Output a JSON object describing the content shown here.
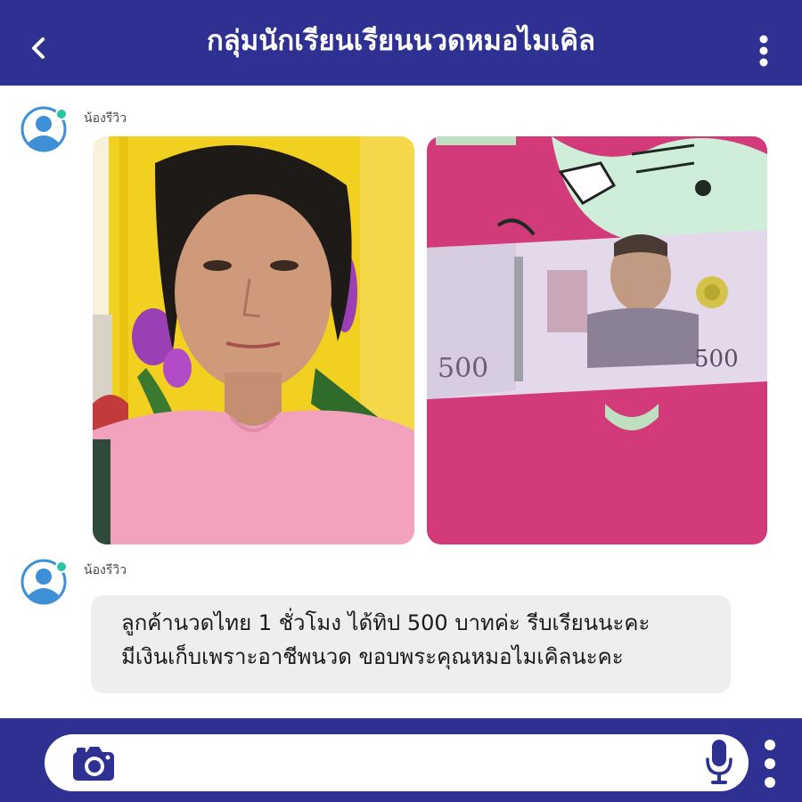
{
  "header": {
    "title": "กลุ่มนักเรียนเรียนนวดหมอไมเคิล",
    "back_icon": "chevron-left-icon",
    "menu_icon": "more-vertical-icon"
  },
  "messages": [
    {
      "sender": "น้องรีวิว",
      "avatar_icon": "user-avatar-icon",
      "online": true,
      "photos": [
        {
          "subject": "woman-portrait-photo"
        },
        {
          "subject": "banknote-500-baht-photo"
        }
      ]
    },
    {
      "sender": "น้องรีวิว",
      "avatar_icon": "user-avatar-icon",
      "online": true,
      "text_lines": [
        "ลูกค้านวดไทย 1 ชั่วโมง ได้ทิป 500 บาทค่ะ รีบเรียนนะคะ",
        "มีเงินเก็บเพราะอาชีพนวด ขอบพระคุณหมอไมเคิลนะคะ"
      ]
    }
  ],
  "banknote": {
    "denomination": "500"
  },
  "composer": {
    "placeholder": "",
    "camera_icon": "camera-icon",
    "mic_icon": "microphone-icon",
    "menu_icon": "more-vertical-icon"
  },
  "colors": {
    "brand": "#2e3192",
    "avatar": "#3d8fd6",
    "online": "#26c6a2",
    "bubble": "#eeeeee"
  }
}
